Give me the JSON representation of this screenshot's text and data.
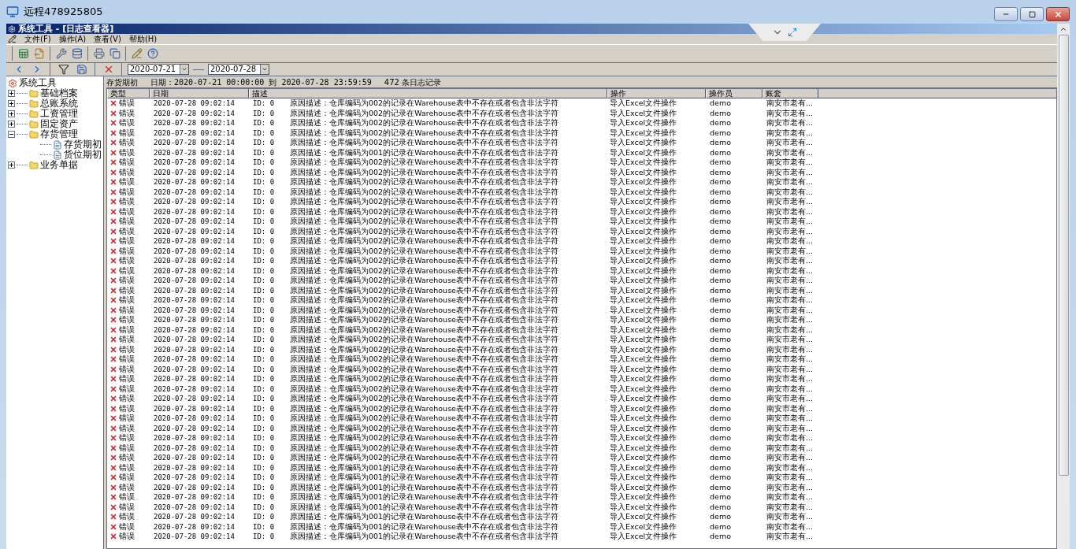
{
  "window": {
    "title": "远程478925805"
  },
  "app": {
    "title": "系统工具 - [日志查看器]"
  },
  "menu": [
    "文件(F)",
    "操作(A)",
    "查看(V)",
    "帮助(H)"
  ],
  "filter": {
    "from": "2020-07-21",
    "to": "2020-07-28"
  },
  "tree": {
    "label": "系统工具",
    "expanded": true,
    "children": [
      {
        "label": "基础档案",
        "expanded": false
      },
      {
        "label": "总账系统",
        "expanded": false
      },
      {
        "label": "工资管理",
        "expanded": false
      },
      {
        "label": "固定资产",
        "expanded": false
      },
      {
        "label": "存货管理",
        "expanded": true,
        "children": [
          {
            "label": "存货期初"
          },
          {
            "label": "货位期初"
          }
        ]
      },
      {
        "label": "业务单据",
        "expanded": false
      }
    ]
  },
  "log": {
    "title": "存货期初",
    "range": "日期：2020-07-21 00:00:00 到 2020-07-28 23:59:59",
    "count": "472 条日志记录"
  },
  "table": {
    "columns": [
      "类型",
      "日期",
      "描述",
      "操作",
      "操作员",
      "账套"
    ],
    "rows": [
      {
        "type": "错误",
        "date": "2020-07-28 09:02:14",
        "id": "ID: 0",
        "description": "原因描述：仓库编码为002的记录在Warehouse表中不存在或者包含非法字符",
        "operation": "导入Excel文件操作",
        "operator": "demo",
        "account": "南安市老有..."
      },
      {
        "type": "错误",
        "date": "2020-07-28 09:02:14",
        "id": "ID: 0",
        "description": "原因描述：仓库编码为002的记录在Warehouse表中不存在或者包含非法字符",
        "operation": "导入Excel文件操作",
        "operator": "demo",
        "account": "南安市老有..."
      },
      {
        "type": "错误",
        "date": "2020-07-28 09:02:14",
        "id": "ID: 0",
        "description": "原因描述：仓库编码为002的记录在Warehouse表中不存在或者包含非法字符",
        "operation": "导入Excel文件操作",
        "operator": "demo",
        "account": "南安市老有..."
      },
      {
        "type": "错误",
        "date": "2020-07-28 09:02:14",
        "id": "ID: 0",
        "description": "原因描述：仓库编码为002的记录在Warehouse表中不存在或者包含非法字符",
        "operation": "导入Excel文件操作",
        "operator": "demo",
        "account": "南安市老有..."
      },
      {
        "type": "错误",
        "date": "2020-07-28 09:02:14",
        "id": "ID: 0",
        "description": "原因描述：仓库编码为002的记录在Warehouse表中不存在或者包含非法字符",
        "operation": "导入Excel文件操作",
        "operator": "demo",
        "account": "南安市老有..."
      },
      {
        "type": "错误",
        "date": "2020-07-28 09:02:14",
        "id": "ID: 0",
        "description": "原因描述：仓库编码为001的记录在Warehouse表中不存在或者包含非法字符",
        "operation": "导入Excel文件操作",
        "operator": "demo",
        "account": "南安市老有..."
      },
      {
        "type": "错误",
        "date": "2020-07-28 09:02:14",
        "id": "ID: 0",
        "description": "原因描述：仓库编码为002的记录在Warehouse表中不存在或者包含非法字符",
        "operation": "导入Excel文件操作",
        "operator": "demo",
        "account": "南安市老有..."
      },
      {
        "type": "错误",
        "date": "2020-07-28 09:02:14",
        "id": "ID: 0",
        "description": "原因描述：仓库编码为002的记录在Warehouse表中不存在或者包含非法字符",
        "operation": "导入Excel文件操作",
        "operator": "demo",
        "account": "南安市老有..."
      },
      {
        "type": "错误",
        "date": "2020-07-28 09:02:14",
        "id": "ID: 0",
        "description": "原因描述：仓库编码为002的记录在Warehouse表中不存在或者包含非法字符",
        "operation": "导入Excel文件操作",
        "operator": "demo",
        "account": "南安市老有..."
      },
      {
        "type": "错误",
        "date": "2020-07-28 09:02:14",
        "id": "ID: 0",
        "description": "原因描述：仓库编码为002的记录在Warehouse表中不存在或者包含非法字符",
        "operation": "导入Excel文件操作",
        "operator": "demo",
        "account": "南安市老有..."
      },
      {
        "type": "错误",
        "date": "2020-07-28 09:02:14",
        "id": "ID: 0",
        "description": "原因描述：仓库编码为002的记录在Warehouse表中不存在或者包含非法字符",
        "operation": "导入Excel文件操作",
        "operator": "demo",
        "account": "南安市老有..."
      },
      {
        "type": "错误",
        "date": "2020-07-28 09:02:14",
        "id": "ID: 0",
        "description": "原因描述：仓库编码为002的记录在Warehouse表中不存在或者包含非法字符",
        "operation": "导入Excel文件操作",
        "operator": "demo",
        "account": "南安市老有..."
      },
      {
        "type": "错误",
        "date": "2020-07-28 09:02:14",
        "id": "ID: 0",
        "description": "原因描述：仓库编码为002的记录在Warehouse表中不存在或者包含非法字符",
        "operation": "导入Excel文件操作",
        "operator": "demo",
        "account": "南安市老有..."
      },
      {
        "type": "错误",
        "date": "2020-07-28 09:02:14",
        "id": "ID: 0",
        "description": "原因描述：仓库编码为002的记录在Warehouse表中不存在或者包含非法字符",
        "operation": "导入Excel文件操作",
        "operator": "demo",
        "account": "南安市老有..."
      },
      {
        "type": "错误",
        "date": "2020-07-28 09:02:14",
        "id": "ID: 0",
        "description": "原因描述：仓库编码为002的记录在Warehouse表中不存在或者包含非法字符",
        "operation": "导入Excel文件操作",
        "operator": "demo",
        "account": "南安市老有..."
      },
      {
        "type": "错误",
        "date": "2020-07-28 09:02:14",
        "id": "ID: 0",
        "description": "原因描述：仓库编码为002的记录在Warehouse表中不存在或者包含非法字符",
        "operation": "导入Excel文件操作",
        "operator": "demo",
        "account": "南安市老有..."
      },
      {
        "type": "错误",
        "date": "2020-07-28 09:02:14",
        "id": "ID: 0",
        "description": "原因描述：仓库编码为002的记录在Warehouse表中不存在或者包含非法字符",
        "operation": "导入Excel文件操作",
        "operator": "demo",
        "account": "南安市老有..."
      },
      {
        "type": "错误",
        "date": "2020-07-28 09:02:14",
        "id": "ID: 0",
        "description": "原因描述：仓库编码为002的记录在Warehouse表中不存在或者包含非法字符",
        "operation": "导入Excel文件操作",
        "operator": "demo",
        "account": "南安市老有..."
      },
      {
        "type": "错误",
        "date": "2020-07-28 09:02:14",
        "id": "ID: 0",
        "description": "原因描述：仓库编码为002的记录在Warehouse表中不存在或者包含非法字符",
        "operation": "导入Excel文件操作",
        "operator": "demo",
        "account": "南安市老有..."
      },
      {
        "type": "错误",
        "date": "2020-07-28 09:02:14",
        "id": "ID: 0",
        "description": "原因描述：仓库编码为002的记录在Warehouse表中不存在或者包含非法字符",
        "operation": "导入Excel文件操作",
        "operator": "demo",
        "account": "南安市老有..."
      },
      {
        "type": "错误",
        "date": "2020-07-28 09:02:14",
        "id": "ID: 0",
        "description": "原因描述：仓库编码为002的记录在Warehouse表中不存在或者包含非法字符",
        "operation": "导入Excel文件操作",
        "operator": "demo",
        "account": "南安市老有..."
      },
      {
        "type": "错误",
        "date": "2020-07-28 09:02:14",
        "id": "ID: 0",
        "description": "原因描述：仓库编码为002的记录在Warehouse表中不存在或者包含非法字符",
        "operation": "导入Excel文件操作",
        "operator": "demo",
        "account": "南安市老有..."
      },
      {
        "type": "错误",
        "date": "2020-07-28 09:02:14",
        "id": "ID: 0",
        "description": "原因描述：仓库编码为002的记录在Warehouse表中不存在或者包含非法字符",
        "operation": "导入Excel文件操作",
        "operator": "demo",
        "account": "南安市老有..."
      },
      {
        "type": "错误",
        "date": "2020-07-28 09:02:14",
        "id": "ID: 0",
        "description": "原因描述：仓库编码为002的记录在Warehouse表中不存在或者包含非法字符",
        "operation": "导入Excel文件操作",
        "operator": "demo",
        "account": "南安市老有..."
      },
      {
        "type": "错误",
        "date": "2020-07-28 09:02:14",
        "id": "ID: 0",
        "description": "原因描述：仓库编码为002的记录在Warehouse表中不存在或者包含非法字符",
        "operation": "导入Excel文件操作",
        "operator": "demo",
        "account": "南安市老有..."
      },
      {
        "type": "错误",
        "date": "2020-07-28 09:02:14",
        "id": "ID: 0",
        "description": "原因描述：仓库编码为002的记录在Warehouse表中不存在或者包含非法字符",
        "operation": "导入Excel文件操作",
        "operator": "demo",
        "account": "南安市老有..."
      },
      {
        "type": "错误",
        "date": "2020-07-28 09:02:14",
        "id": "ID: 0",
        "description": "原因描述：仓库编码为002的记录在Warehouse表中不存在或者包含非法字符",
        "operation": "导入Excel文件操作",
        "operator": "demo",
        "account": "南安市老有..."
      },
      {
        "type": "错误",
        "date": "2020-07-28 09:02:14",
        "id": "ID: 0",
        "description": "原因描述：仓库编码为002的记录在Warehouse表中不存在或者包含非法字符",
        "operation": "导入Excel文件操作",
        "operator": "demo",
        "account": "南安市老有..."
      },
      {
        "type": "错误",
        "date": "2020-07-28 09:02:14",
        "id": "ID: 0",
        "description": "原因描述：仓库编码为002的记录在Warehouse表中不存在或者包含非法字符",
        "operation": "导入Excel文件操作",
        "operator": "demo",
        "account": "南安市老有..."
      },
      {
        "type": "错误",
        "date": "2020-07-28 09:02:14",
        "id": "ID: 0",
        "description": "原因描述：仓库编码为002的记录在Warehouse表中不存在或者包含非法字符",
        "operation": "导入Excel文件操作",
        "operator": "demo",
        "account": "南安市老有..."
      },
      {
        "type": "错误",
        "date": "2020-07-28 09:02:14",
        "id": "ID: 0",
        "description": "原因描述：仓库编码为002的记录在Warehouse表中不存在或者包含非法字符",
        "operation": "导入Excel文件操作",
        "operator": "demo",
        "account": "南安市老有..."
      },
      {
        "type": "错误",
        "date": "2020-07-28 09:02:14",
        "id": "ID: 0",
        "description": "原因描述：仓库编码为002的记录在Warehouse表中不存在或者包含非法字符",
        "operation": "导入Excel文件操作",
        "operator": "demo",
        "account": "南安市老有..."
      },
      {
        "type": "错误",
        "date": "2020-07-28 09:02:14",
        "id": "ID: 0",
        "description": "原因描述：仓库编码为002的记录在Warehouse表中不存在或者包含非法字符",
        "operation": "导入Excel文件操作",
        "operator": "demo",
        "account": "南安市老有..."
      },
      {
        "type": "错误",
        "date": "2020-07-28 09:02:14",
        "id": "ID: 0",
        "description": "原因描述：仓库编码为002的记录在Warehouse表中不存在或者包含非法字符",
        "operation": "导入Excel文件操作",
        "operator": "demo",
        "account": "南安市老有..."
      },
      {
        "type": "错误",
        "date": "2020-07-28 09:02:14",
        "id": "ID: 0",
        "description": "原因描述：仓库编码为002的记录在Warehouse表中不存在或者包含非法字符",
        "operation": "导入Excel文件操作",
        "operator": "demo",
        "account": "南安市老有..."
      },
      {
        "type": "错误",
        "date": "2020-07-28 09:02:14",
        "id": "ID: 0",
        "description": "原因描述：仓库编码为002的记录在Warehouse表中不存在或者包含非法字符",
        "operation": "导入Excel文件操作",
        "operator": "demo",
        "account": "南安市老有..."
      },
      {
        "type": "错误",
        "date": "2020-07-28 09:02:14",
        "id": "ID: 0",
        "description": "原因描述：仓库编码为002的记录在Warehouse表中不存在或者包含非法字符",
        "operation": "导入Excel文件操作",
        "operator": "demo",
        "account": "南安市老有..."
      },
      {
        "type": "错误",
        "date": "2020-07-28 09:02:14",
        "id": "ID: 0",
        "description": "原因描述：仓库编码为001的记录在Warehouse表中不存在或者包含非法字符",
        "operation": "导入Excel文件操作",
        "operator": "demo",
        "account": "南安市老有..."
      },
      {
        "type": "错误",
        "date": "2020-07-28 09:02:14",
        "id": "ID: 0",
        "description": "原因描述：仓库编码为001的记录在Warehouse表中不存在或者包含非法字符",
        "operation": "导入Excel文件操作",
        "operator": "demo",
        "account": "南安市老有..."
      },
      {
        "type": "错误",
        "date": "2020-07-28 09:02:14",
        "id": "ID: 0",
        "description": "原因描述：仓库编码为001的记录在Warehouse表中不存在或者包含非法字符",
        "operation": "导入Excel文件操作",
        "operator": "demo",
        "account": "南安市老有..."
      },
      {
        "type": "错误",
        "date": "2020-07-28 09:02:14",
        "id": "ID: 0",
        "description": "原因描述：仓库编码为001的记录在Warehouse表中不存在或者包含非法字符",
        "operation": "导入Excel文件操作",
        "operator": "demo",
        "account": "南安市老有..."
      },
      {
        "type": "错误",
        "date": "2020-07-28 09:02:14",
        "id": "ID: 0",
        "description": "原因描述：仓库编码为001的记录在Warehouse表中不存在或者包含非法字符",
        "operation": "导入Excel文件操作",
        "operator": "demo",
        "account": "南安市老有..."
      },
      {
        "type": "错误",
        "date": "2020-07-28 09:02:14",
        "id": "ID: 0",
        "description": "原因描述：仓库编码为001的记录在Warehouse表中不存在或者包含非法字符",
        "operation": "导入Excel文件操作",
        "operator": "demo",
        "account": "南安市老有..."
      },
      {
        "type": "错误",
        "date": "2020-07-28 09:02:14",
        "id": "ID: 0",
        "description": "原因描述：仓库编码为001的记录在Warehouse表中不存在或者包含非法字符",
        "operation": "导入Excel文件操作",
        "operator": "demo",
        "account": "南安市老有..."
      },
      {
        "type": "错误",
        "date": "2020-07-28 09:02:14",
        "id": "ID: 0",
        "description": "原因描述：仓库编码为001的记录在Warehouse表中不存在或者包含非法字符",
        "operation": "导入Excel文件操作",
        "operator": "demo",
        "account": "南安市老有..."
      }
    ]
  }
}
